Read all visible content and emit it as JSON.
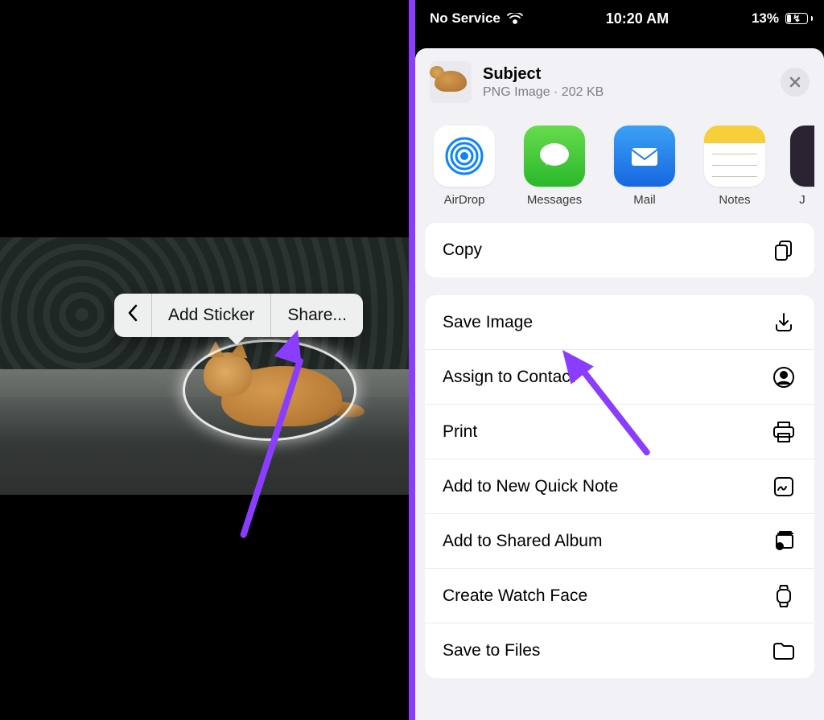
{
  "left": {
    "menu": {
      "back_icon": "chevron-left",
      "add_sticker": "Add Sticker",
      "share": "Share..."
    }
  },
  "right": {
    "status": {
      "carrier": "No Service",
      "time": "10:20 AM",
      "battery_pct": "13%"
    },
    "header": {
      "title": "Subject",
      "subtitle": "PNG Image · 202 KB"
    },
    "apps": [
      {
        "label": "AirDrop"
      },
      {
        "label": "Messages"
      },
      {
        "label": "Mail"
      },
      {
        "label": "Notes"
      },
      {
        "label": "J"
      }
    ],
    "copy_label": "Copy",
    "actions": [
      {
        "label": "Save Image",
        "icon": "download"
      },
      {
        "label": "Assign to Contact",
        "icon": "contact"
      },
      {
        "label": "Print",
        "icon": "print"
      },
      {
        "label": "Add to New Quick Note",
        "icon": "quicknote"
      },
      {
        "label": "Add to Shared Album",
        "icon": "sharedalbum"
      },
      {
        "label": "Create Watch Face",
        "icon": "watch"
      },
      {
        "label": "Save to Files",
        "icon": "folder"
      }
    ]
  }
}
